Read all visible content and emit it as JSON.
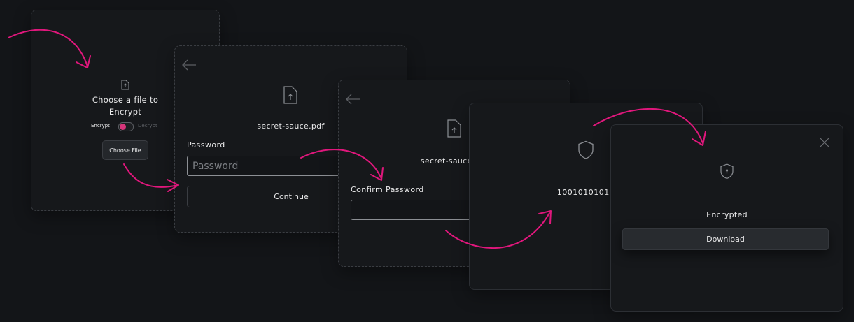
{
  "card1": {
    "title": "Choose a file to Encrypt",
    "toggle_left": "Encrypt",
    "toggle_right": "Decrypt",
    "choose_button": "Choose File",
    "accent": "#d6357a"
  },
  "card2": {
    "filename": "secret-sauce.pdf",
    "password_label": "Password",
    "password_placeholder": "Password",
    "continue_button": "Continue"
  },
  "card3": {
    "filename": "secret-sauce.pdf",
    "confirm_label": "Confirm Password"
  },
  "card4": {
    "binary": "10010101010"
  },
  "card5": {
    "status": "Encrypted",
    "download_button": "Download"
  },
  "colors": {
    "background": "#131518",
    "card": "#16181b",
    "arrow": "#e0177c"
  }
}
